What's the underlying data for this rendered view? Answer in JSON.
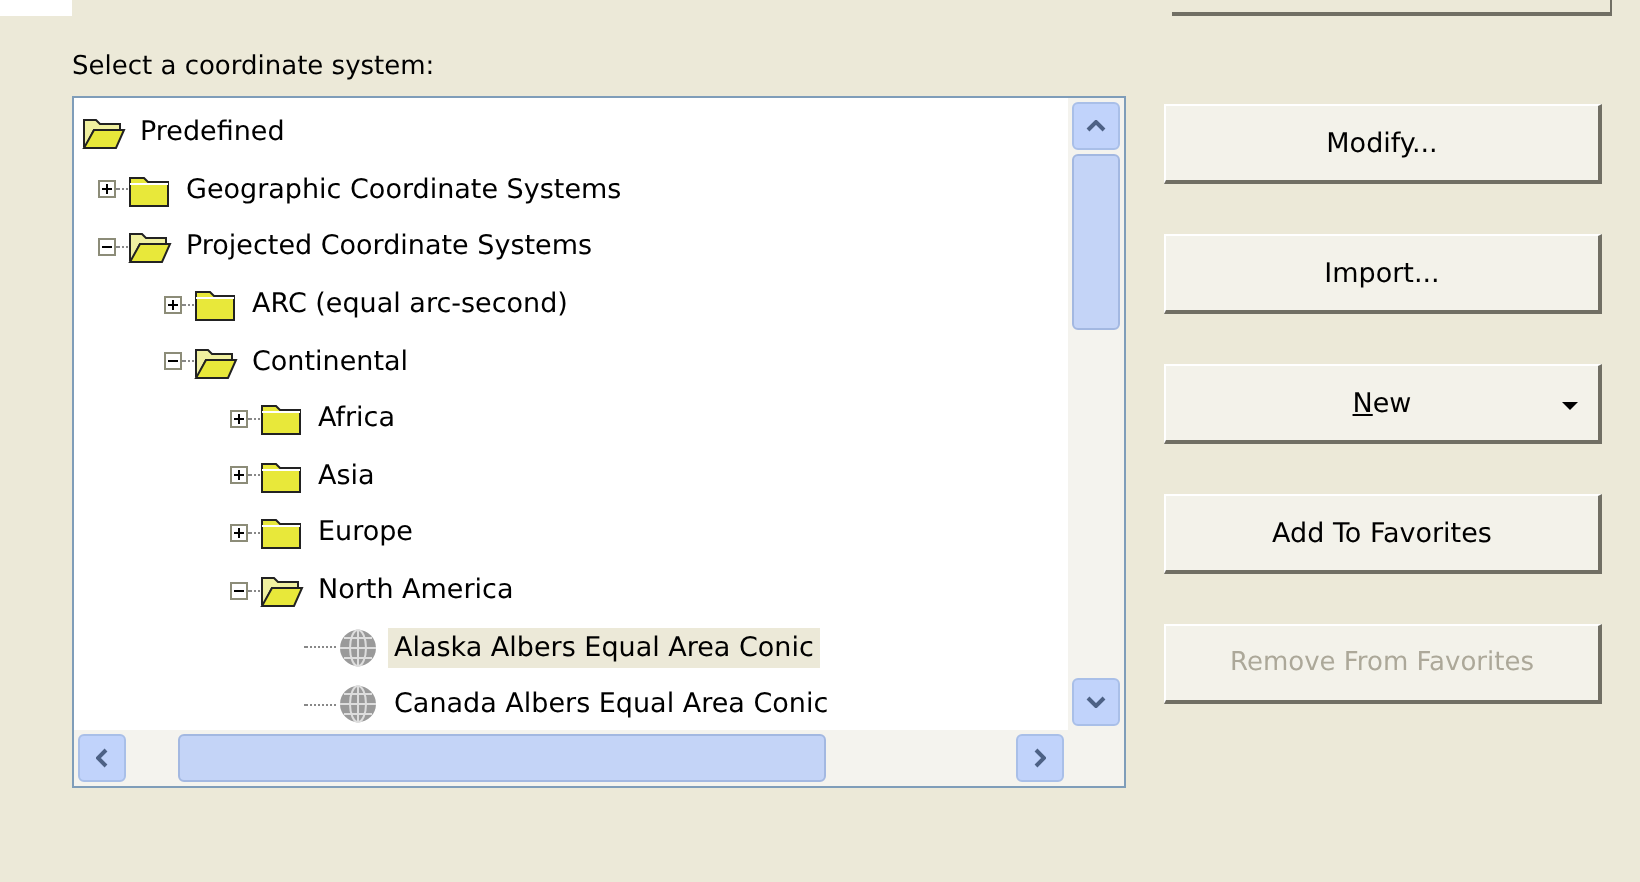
{
  "label": "Select a coordinate system:",
  "tree": [
    {
      "label": "Predefined",
      "kind": "folder",
      "expanded": true,
      "selected": false,
      "children": [
        {
          "label": "Geographic Coordinate Systems",
          "kind": "folder",
          "expanded": false,
          "selected": false
        },
        {
          "label": "Projected Coordinate Systems",
          "kind": "folder",
          "expanded": true,
          "selected": false,
          "children": [
            {
              "label": "ARC (equal arc-second)",
              "kind": "folder",
              "expanded": false,
              "selected": false
            },
            {
              "label": "Continental",
              "kind": "folder",
              "expanded": true,
              "selected": false,
              "children": [
                {
                  "label": "Africa",
                  "kind": "folder",
                  "expanded": false,
                  "selected": false
                },
                {
                  "label": "Asia",
                  "kind": "folder",
                  "expanded": false,
                  "selected": false
                },
                {
                  "label": "Europe",
                  "kind": "folder",
                  "expanded": false,
                  "selected": false
                },
                {
                  "label": "North America",
                  "kind": "folder",
                  "expanded": true,
                  "selected": false,
                  "children": [
                    {
                      "label": "Alaska Albers Equal Area Conic",
                      "kind": "projection",
                      "selected": true
                    },
                    {
                      "label": "Canada Albers Equal Area Conic",
                      "kind": "projection",
                      "selected": false
                    }
                  ]
                }
              ]
            }
          ]
        }
      ]
    }
  ],
  "buttons": [
    {
      "label": "Modify...",
      "kind": "plain",
      "disabled": false
    },
    {
      "label": "Import...",
      "kind": "plain",
      "disabled": false
    },
    {
      "label": "New",
      "kind": "dropdown",
      "disabled": false
    },
    {
      "label": "Add To Favorites",
      "kind": "plain",
      "disabled": false
    },
    {
      "label": "Remove From Favorites",
      "kind": "plain",
      "disabled": true
    }
  ]
}
